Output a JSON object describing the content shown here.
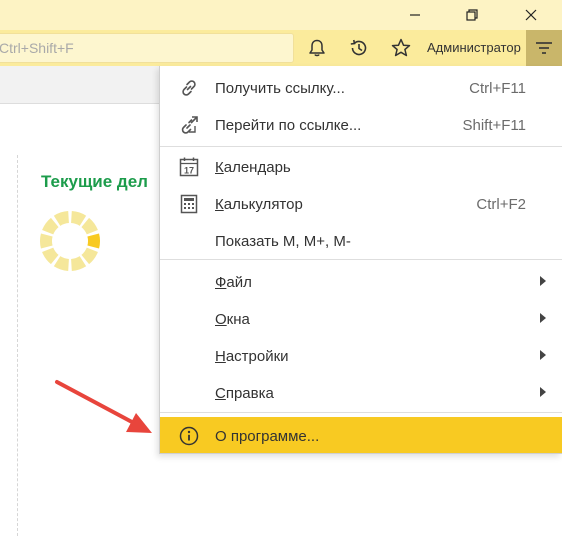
{
  "window": {
    "buttons": [
      {
        "name": "minimize-button",
        "icon": "minimize-icon"
      },
      {
        "name": "restore-button",
        "icon": "restore-icon"
      },
      {
        "name": "close-button",
        "icon": "close-icon"
      }
    ]
  },
  "toolbar": {
    "search_placeholder": "Ctrl+Shift+F",
    "icons": [
      "bell-icon",
      "history-icon",
      "star-icon"
    ],
    "user_name": "Администратор",
    "menu_icon": "hamburger-menu-icon"
  },
  "main": {
    "section_title": "Текущие дел",
    "loading_icon": "loading-spinner-icon"
  },
  "menu": {
    "items": [
      {
        "label": "Получить ссылку...",
        "shortcut": "Ctrl+F11",
        "icon": "link-icon"
      },
      {
        "label": "Перейти по ссылке...",
        "shortcut": "Shift+F11",
        "icon": "link-arrow-icon"
      },
      {
        "label_underlined": "К",
        "label_rest": "алендарь",
        "shortcut": "",
        "icon": "calendar-icon",
        "calendar_day": "17"
      },
      {
        "label_underlined": "К",
        "label_rest": "алькулятор",
        "shortcut": "Ctrl+F2",
        "icon": "calculator-icon"
      },
      {
        "label": "Показать M, M+, M-",
        "shortcut": ""
      },
      {
        "label_underlined": "Ф",
        "label_rest": "айл",
        "submenu": true
      },
      {
        "label_underlined": "О",
        "label_rest": "кна",
        "submenu": true
      },
      {
        "label_underlined": "Н",
        "label_rest": "астройки",
        "submenu": true
      },
      {
        "label_underlined": "С",
        "label_rest": "правка",
        "submenu": true
      },
      {
        "label": "О программе...",
        "icon": "info-icon",
        "highlighted": true
      }
    ]
  },
  "colors": {
    "toolbar_bg": "#fbeb9c",
    "titlebar_bg": "#fdf3c4",
    "highlight": "#f8ca22",
    "section_title": "#1c9c4b",
    "annotation_arrow": "#e8453c",
    "spinner": "#f5e79a"
  }
}
